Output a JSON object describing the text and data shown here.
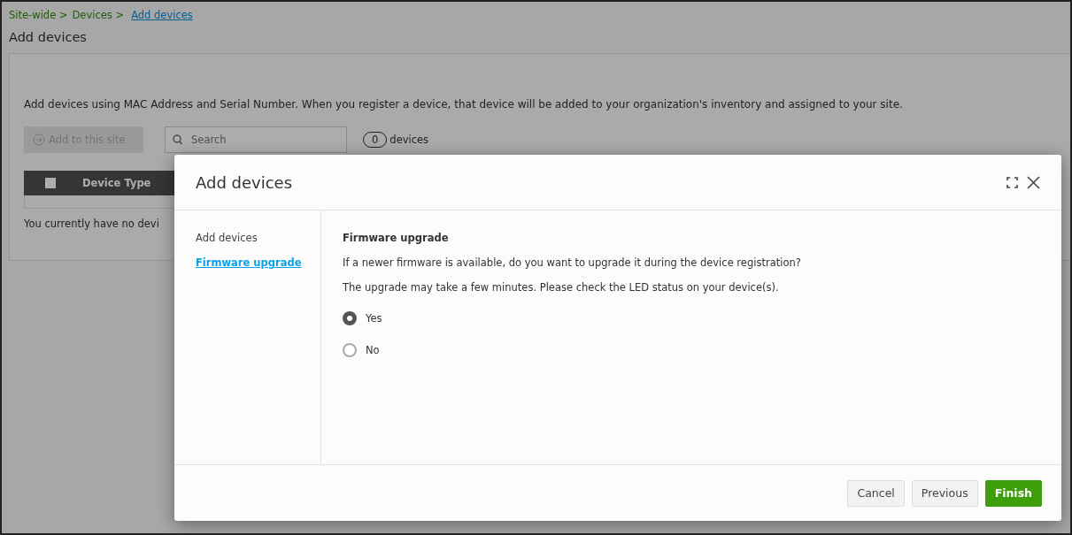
{
  "breadcrumb": {
    "items": [
      "Site-wide >",
      "Devices >"
    ],
    "current": "Add devices"
  },
  "page_title": "Add devices",
  "description": "Add devices using MAC Address and Serial Number. When you register a device, that device will be added to your organization's inventory and assigned to your site.",
  "toolbar": {
    "add_button": {
      "label": "Add to this site",
      "disabled": true
    },
    "search": {
      "placeholder": "Search"
    },
    "count": "0",
    "count_label": "devices"
  },
  "table": {
    "select_all": {
      "checked": false
    },
    "columns": [
      "Device Type"
    ],
    "empty_message": "You currently have no devi"
  },
  "dialog": {
    "title": "Add devices",
    "steps": [
      {
        "label": "Add devices",
        "selected": false
      },
      {
        "label": "Firmware upgrade",
        "selected": true
      }
    ],
    "section_title": "Firmware upgrade",
    "paragraphs": [
      "If a newer firmware is available, do you want to upgrade it during the device registration?",
      "The upgrade may take a few minutes. Please check the LED status on your device(s)."
    ],
    "options": [
      {
        "label": "Yes",
        "selected": true
      },
      {
        "label": "No",
        "selected": false
      }
    ],
    "buttons": [
      {
        "label": "Cancel",
        "kind": "secondary"
      },
      {
        "label": "Previous",
        "kind": "secondary"
      },
      {
        "label": "Finish",
        "kind": "primary"
      }
    ]
  }
}
